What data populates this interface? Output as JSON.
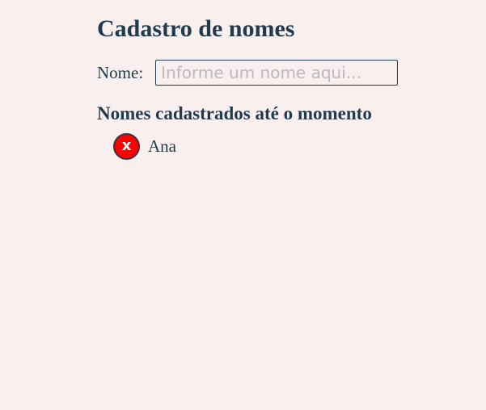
{
  "title": "Cadastro de nomes",
  "form": {
    "label": "Nome:",
    "value": "",
    "placeholder": "Informe um nome aqui..."
  },
  "list": {
    "heading": "Nomes cadastrados até o momento",
    "items": [
      {
        "name": "Ana",
        "remove_glyph": "x",
        "remove_icon": "close-icon",
        "remove_color": "#ff0000"
      }
    ]
  }
}
